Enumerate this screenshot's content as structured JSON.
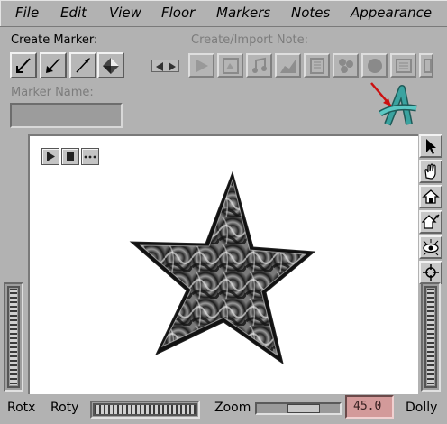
{
  "menu": [
    "File",
    "Edit",
    "View",
    "Floor",
    "Markers",
    "Notes",
    "Appearance"
  ],
  "create_marker": {
    "label": "Create Marker:"
  },
  "create_note": {
    "label": "Create/Import Note:"
  },
  "marker_name": {
    "label": "Marker Name:",
    "value": ""
  },
  "bottom": {
    "rotx": "Rotx",
    "roty": "Roty",
    "zoom": "Zoom",
    "zoom_value": "45.0",
    "dolly": "Dolly"
  },
  "colors": {
    "background": "#b2b2b2",
    "viewer": "#ffffff",
    "zoom_field": "#d39a9a",
    "logo_teal": "#3aa3a0",
    "arrow_red": "#cc1010"
  }
}
